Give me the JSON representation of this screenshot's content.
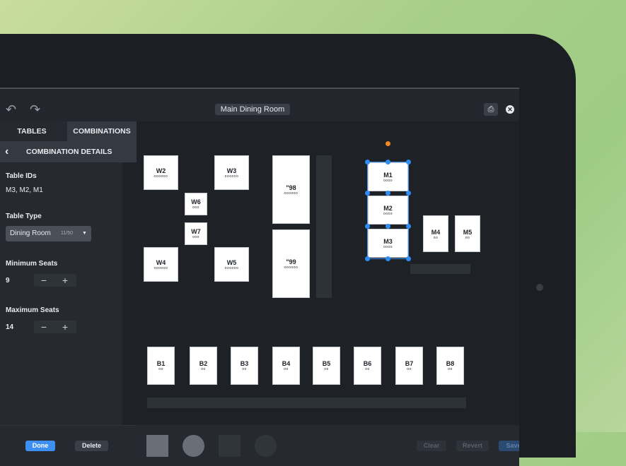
{
  "toolbar": {
    "undo_icon": "undo-icon",
    "redo_icon": "redo-icon",
    "room_title": "Main Dining Room",
    "print_icon": "printer-icon",
    "close_icon": "close-icon"
  },
  "sidebar": {
    "tabs": [
      {
        "label": "TABLES",
        "active": false
      },
      {
        "label": "COMBINATIONS",
        "active": true
      }
    ],
    "section_title": "COMBINATION DETAILS",
    "table_ids_label": "Table IDs",
    "table_ids_value": "M3, M2, M1",
    "table_type_label": "Table Type",
    "table_type_value": "Dining Room",
    "table_type_count": "11/50",
    "min_seats_label": "Minimum Seats",
    "min_seats_value": "9",
    "max_seats_label": "Maximum Seats",
    "max_seats_value": "14",
    "minus": "−",
    "plus": "+",
    "done_label": "Done",
    "delete_label": "Delete"
  },
  "floor": {
    "tables": [
      {
        "id": "W2",
        "seats": "oooooo"
      },
      {
        "id": "W3",
        "seats": "oooooo"
      },
      {
        "id": "W6",
        "seats": "ooo"
      },
      {
        "id": "W7",
        "seats": "ooo"
      },
      {
        "id": "W4",
        "seats": "oooooo"
      },
      {
        "id": "W5",
        "seats": "oooooo"
      },
      {
        "id": "\"98",
        "seats": "oooooo"
      },
      {
        "id": "\"99",
        "seats": "oooooo"
      },
      {
        "id": "M1",
        "seats": "oooo"
      },
      {
        "id": "M2",
        "seats": "oooo"
      },
      {
        "id": "M3",
        "seats": "oooo"
      },
      {
        "id": "M4",
        "seats": "oo"
      },
      {
        "id": "M5",
        "seats": "oo"
      },
      {
        "id": "B1",
        "seats": "oo"
      },
      {
        "id": "B2",
        "seats": "oo"
      },
      {
        "id": "B3",
        "seats": "oo"
      },
      {
        "id": "B4",
        "seats": "oo"
      },
      {
        "id": "B5",
        "seats": "oo"
      },
      {
        "id": "B6",
        "seats": "oo"
      },
      {
        "id": "B7",
        "seats": "oo"
      },
      {
        "id": "B8",
        "seats": "oo"
      }
    ],
    "selected_combination": [
      "M1",
      "M2",
      "M3"
    ]
  },
  "bottom_bar": {
    "shapes": [
      "square-table",
      "round-table",
      "square-table-dark",
      "round-table-dark"
    ],
    "clear_label": "Clear",
    "revert_label": "Revert",
    "save_label": "Save"
  },
  "colors": {
    "accent": "#3d8ff2",
    "rotate_handle": "#f08a24",
    "canvas_bg": "#1e2227"
  }
}
